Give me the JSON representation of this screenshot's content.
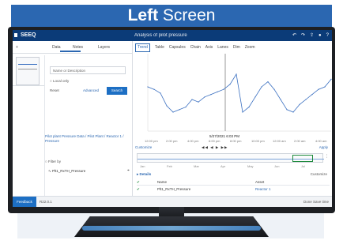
{
  "banner": {
    "bold": "Left",
    "rest": " Screen"
  },
  "colors": {
    "banner": "#2b67b1",
    "topbar": "#0b3b78",
    "accent": "#1d6fc4",
    "signal": "#3a6fc0",
    "capsule": "#1e8a3c"
  },
  "app": {
    "logo": "SEEQ",
    "worksheet_title": "Analysis of pilot pressure"
  },
  "left_panel": {
    "tabs": [
      "Data",
      "Notes",
      "Layers"
    ],
    "search_placeholder": "Name or Description",
    "local_only": "Local only",
    "reset": "Reset",
    "advanced": "Advanced",
    "search_button": "Search",
    "path": "Pilot plant Pressure Data / Pilot Plant / Reactor 1 / Pressure",
    "filter": "Filter by",
    "item": "Plt1_RxTH_Pressure"
  },
  "toolbar": {
    "items": [
      "Trend",
      "Table",
      "Capsules",
      "Chain",
      "Axis",
      "Lanes",
      "Dim",
      "Zoom"
    ]
  },
  "chart": {
    "timestamp": "5/27/2021 6:03 PM",
    "xticks": [
      "12:00 pm",
      "2:00 pm",
      "4:00 pm",
      "6:00 pm",
      "8:00 pm",
      "10:00 pm",
      "12:00 am",
      "2:00 am",
      "4:00 am"
    ],
    "controls_left": "Customize",
    "controls_right": "Apply"
  },
  "overview": {
    "ticks": [
      "Jan",
      "Feb",
      "Mar",
      "Apr",
      "May",
      "Jun",
      "Jul"
    ]
  },
  "details": {
    "header": "Details",
    "customize": "Customize",
    "cols": [
      "Name",
      "Asset"
    ],
    "row": {
      "name": "Plt1_RxTH_Pressure",
      "asset": "Reactor 1"
    }
  },
  "footer": {
    "feedback": "Feedback",
    "version": "R22.0.1",
    "right": "Done  Save time"
  },
  "chart_data": {
    "type": "line",
    "series": [
      {
        "values": [
          60,
          58,
          55,
          45,
          40,
          42,
          44,
          50,
          48,
          52,
          54,
          56,
          58,
          62,
          70,
          40,
          44,
          52,
          60,
          64,
          58,
          50,
          42,
          40,
          46,
          50,
          54,
          58,
          60,
          66
        ]
      }
    ]
  }
}
